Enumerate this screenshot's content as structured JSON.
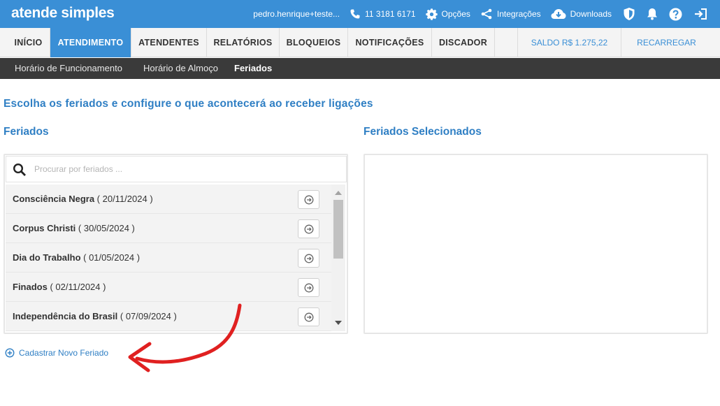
{
  "topbar": {
    "logo": "atende simples",
    "user": "pedro.henrique+teste...",
    "phone": "11 3181 6171",
    "options": "Opções",
    "integrations": "Integrações",
    "downloads": "Downloads"
  },
  "nav": {
    "tabs": [
      {
        "label": "INÍCIO"
      },
      {
        "label": "ATENDIMENTO"
      },
      {
        "label": "ATENDENTES"
      },
      {
        "label": "RELATÓRIOS"
      },
      {
        "label": "BLOQUEIOS"
      },
      {
        "label": "NOTIFICAÇÕES"
      },
      {
        "label": "DISCADOR"
      }
    ],
    "active_tab": "ATENDIMENTO",
    "balance": "SALDO R$ 1.275,22",
    "recharge": "RECARREGAR"
  },
  "subnav": {
    "items": [
      {
        "label": "Horário de Funcionamento"
      },
      {
        "label": "Horário de Almoço"
      },
      {
        "label": "Feriados"
      }
    ],
    "active_item": "Feriados"
  },
  "page": {
    "heading": "Escolha os feriados e configure o que acontecerá ao receber ligações",
    "holidays_title": "Feriados",
    "selected_title": "Feriados Selecionados",
    "search_placeholder": "Procurar por feriados ...",
    "holidays": [
      {
        "name": "Consciência Negra",
        "date": "( 20/11/2024 )"
      },
      {
        "name": "Corpus Christi",
        "date": "( 30/05/2024 )"
      },
      {
        "name": "Dia do Trabalho",
        "date": "( 01/05/2024 )"
      },
      {
        "name": "Finados",
        "date": "( 02/11/2024 )"
      },
      {
        "name": "Independência do Brasil",
        "date": "( 07/09/2024 )"
      }
    ],
    "add_link": "Cadastrar Novo Feriado"
  },
  "colors": {
    "brand_blue": "#3a8fd6",
    "heading_blue": "#2f7fc4",
    "subnav_dark": "#3a3a3a",
    "annotation_red": "#e02020"
  },
  "icons": [
    "phone-icon",
    "gear-icon",
    "share-icon",
    "cloud-download-icon",
    "shield-icon",
    "bell-icon",
    "help-icon",
    "logout-icon",
    "search-icon",
    "arrow-circle-right-icon",
    "plus-circle-icon"
  ]
}
